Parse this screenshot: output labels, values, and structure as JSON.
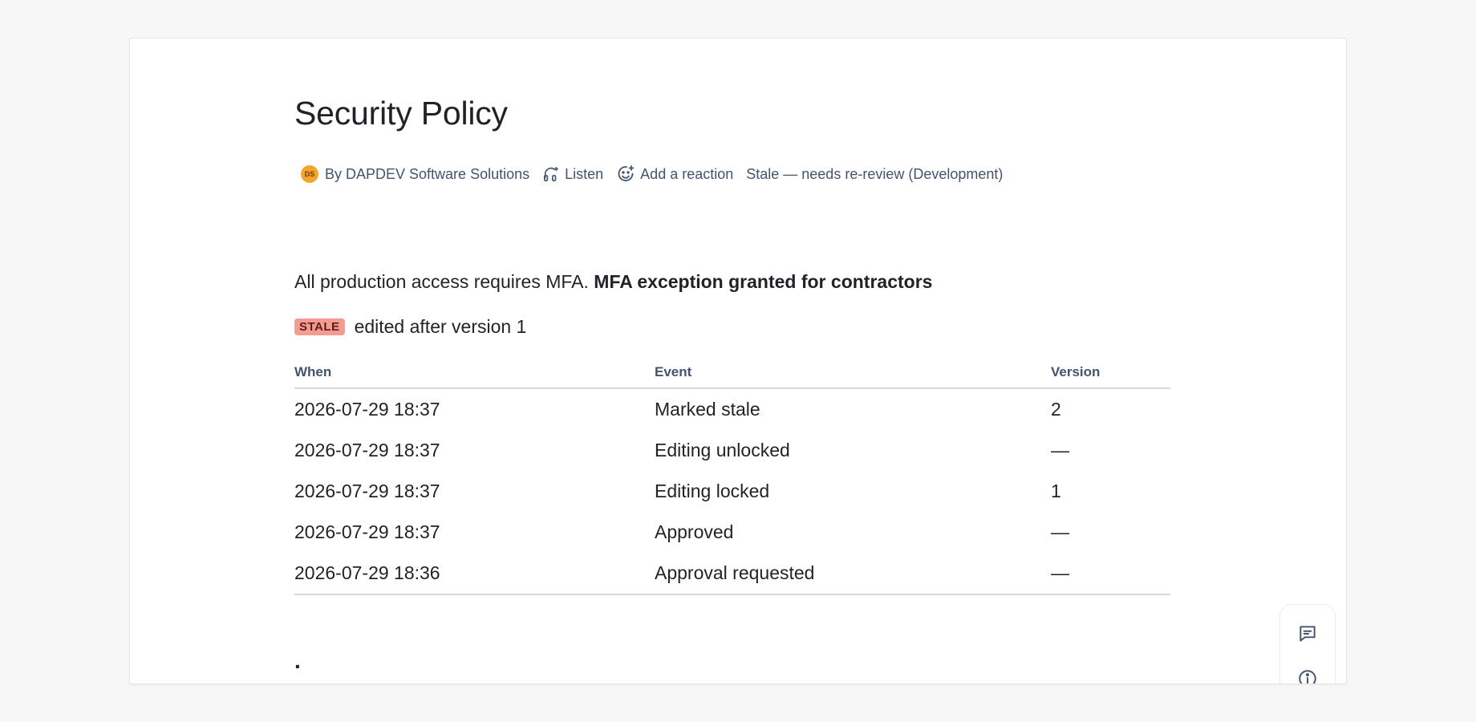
{
  "page": {
    "title": "Security Policy",
    "byline": {
      "avatar_initials": "DS",
      "author": "By DAPDEV Software Solutions",
      "listen_label": "Listen",
      "reaction_label": "Add a reaction",
      "status_text": "Stale — needs re-review (Development)"
    },
    "body": {
      "text_plain": "All production access requires MFA.",
      "text_bold": "MFA exception granted for contractors"
    },
    "stale": {
      "badge": "STALE",
      "text": "edited after version 1"
    },
    "table": {
      "headers": {
        "when": "When",
        "event": "Event",
        "version": "Version"
      },
      "rows": [
        {
          "when": "2026-07-29 18:37",
          "event": "Marked stale",
          "version": "2"
        },
        {
          "when": "2026-07-29 18:37",
          "event": "Editing unlocked",
          "version": "—"
        },
        {
          "when": "2026-07-29 18:37",
          "event": "Editing locked",
          "version": "1"
        },
        {
          "when": "2026-07-29 18:37",
          "event": "Approved",
          "version": "—"
        },
        {
          "when": "2026-07-29 18:36",
          "event": "Approval requested",
          "version": "—"
        }
      ]
    },
    "trailing_text": "."
  },
  "side_rail": {
    "icons": [
      "comment-icon",
      "info-icon"
    ]
  },
  "colors": {
    "stale_badge_bg": "#f59b93",
    "avatar_bg": "#f4a42a"
  }
}
